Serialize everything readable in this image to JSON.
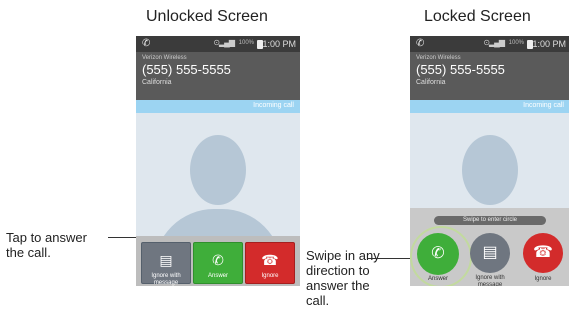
{
  "headings": {
    "unlocked": "Unlocked Screen",
    "locked": "Locked Screen"
  },
  "annotations": {
    "tap": [
      "Tap to answer",
      "the call."
    ],
    "swipe": [
      "Swipe in any",
      "direction to",
      "answer the",
      "call."
    ]
  },
  "phone": {
    "status_time": "1:00 PM",
    "battery": "100%",
    "carrier": "Verizon Wireless",
    "number": "(555) 555-5555",
    "location": "California",
    "incoming": "Incoming call"
  },
  "unlocked_buttons": {
    "ignore_with_message": "Ignore with message",
    "answer": "Answer",
    "ignore": "Ignore"
  },
  "locked": {
    "swipe_hint": "Swipe to enter circle",
    "answer": "Answer",
    "ignore_with_message": "Ignore with message",
    "ignore": "Ignore"
  },
  "colors": {
    "answer_green": "#3fae3a",
    "ignore_red": "#d32b2b",
    "message_gray": "#6f7680",
    "incoming_blue": "#9cd4f2"
  },
  "icons": {
    "phone": "phone-icon",
    "message": "message-icon",
    "hangup": "hangup-icon"
  }
}
